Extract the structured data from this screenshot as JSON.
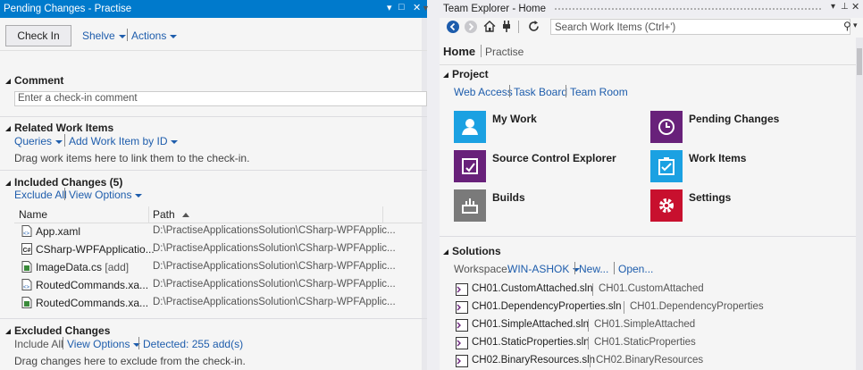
{
  "left_panel": {
    "title": "Pending Changes - Practise",
    "check_in_label": "Check In",
    "shelve_label": "Shelve",
    "actions_label": "Actions",
    "comment": {
      "heading": "Comment",
      "placeholder": "Enter a check-in comment"
    },
    "related": {
      "heading": "Related Work Items",
      "queries_label": "Queries",
      "add_label": "Add Work Item by ID",
      "hint": "Drag work items here to link them to the check-in."
    },
    "included": {
      "heading": "Included Changes (5)",
      "exclude_all_label": "Exclude All",
      "view_options_label": "View Options",
      "col_name": "Name",
      "col_path": "Path",
      "rows": [
        {
          "name": "App.xaml",
          "tag": "",
          "path": "D:\\PractiseApplicationsSolution\\CSharp-WPFApplic..."
        },
        {
          "name": "CSharp-WPFApplicatio...",
          "tag": "",
          "path": "D:\\PractiseApplicationsSolution\\CSharp-WPFApplic..."
        },
        {
          "name": "ImageData.cs",
          "tag": "[add]",
          "path": "D:\\PractiseApplicationsSolution\\CSharp-WPFApplic..."
        },
        {
          "name": "RoutedCommands.xa...",
          "tag": "",
          "path": "D:\\PractiseApplicationsSolution\\CSharp-WPFApplic..."
        },
        {
          "name": "RoutedCommands.xa...",
          "tag": "",
          "path": "D:\\PractiseApplicationsSolution\\CSharp-WPFApplic..."
        }
      ]
    },
    "excluded": {
      "heading": "Excluded Changes",
      "include_all_label": "Include All",
      "view_options_label": "View Options",
      "detected_label": "Detected: 255 add(s)",
      "hint": "Drag changes here to exclude from the check-in."
    }
  },
  "right_panel": {
    "title": "Team Explorer - Home",
    "search_placeholder": "Search Work Items (Ctrl+')",
    "home_label": "Home",
    "context_label": "Practise",
    "project": {
      "heading": "Project",
      "links": [
        "Web Access",
        "Task Board",
        "Team Room"
      ],
      "tiles": [
        {
          "label": "My Work",
          "color": "#1ba1e2",
          "icon": "my-work-icon"
        },
        {
          "label": "Pending Changes",
          "color": "#68217a",
          "icon": "clock-icon"
        },
        {
          "label": "Source Control Explorer",
          "color": "#68217a",
          "icon": "source-control-icon"
        },
        {
          "label": "Work Items",
          "color": "#1ba1e2",
          "icon": "work-items-icon"
        },
        {
          "label": "Builds",
          "color": "#7a7a7a",
          "icon": "builds-icon"
        },
        {
          "label": "Settings",
          "color": "#c8102e",
          "icon": "settings-gear-icon"
        }
      ]
    },
    "solutions": {
      "heading": "Solutions",
      "workspace_label": "Workspace:",
      "workspace_value": "WIN-ASHOK",
      "new_label": "New...",
      "open_label": "Open...",
      "items": [
        {
          "file": "CH01.CustomAttached.sln",
          "project": "CH01.CustomAttached"
        },
        {
          "file": "CH01.DependencyProperties.sln",
          "project": "CH01.DependencyProperties"
        },
        {
          "file": "CH01.SimpleAttached.sln",
          "project": "CH01.SimpleAttached"
        },
        {
          "file": "CH01.StaticProperties.sln",
          "project": "CH01.StaticProperties"
        },
        {
          "file": "CH02.BinaryResources.sln",
          "project": "CH02.BinaryResources"
        }
      ]
    }
  },
  "colors": {
    "accent": "#007acc",
    "link": "#1e5dac"
  }
}
